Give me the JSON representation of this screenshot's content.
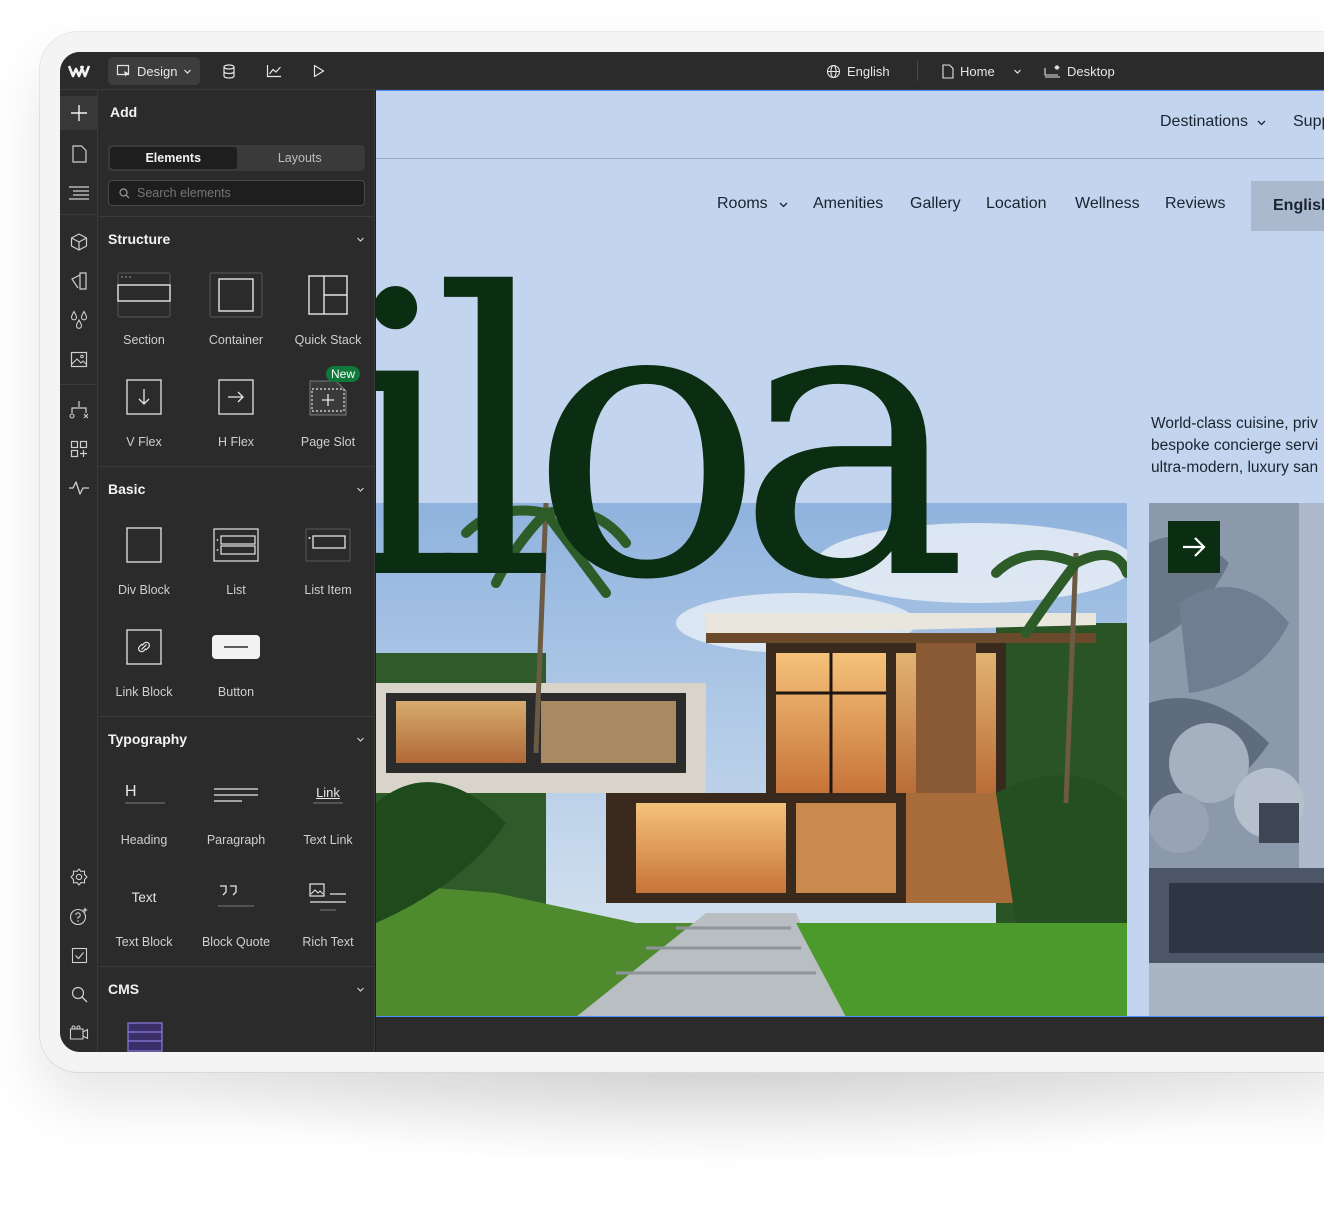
{
  "app": {
    "mode_label": "Design",
    "language": "English",
    "page": "Home",
    "breakpoint": "Desktop"
  },
  "panel": {
    "title": "Add",
    "tabs": [
      "Elements",
      "Layouts"
    ],
    "search_placeholder": "Search elements",
    "new_badge": "New",
    "sections": {
      "structure": {
        "title": "Structure",
        "items": [
          "Section",
          "Container",
          "Quick Stack",
          "V Flex",
          "H Flex",
          "Page Slot"
        ]
      },
      "basic": {
        "title": "Basic",
        "items": [
          "Div Block",
          "List",
          "List Item",
          "Link Block",
          "Button"
        ]
      },
      "typography": {
        "title": "Typography",
        "items": [
          "Heading",
          "Paragraph",
          "Text Link",
          "Text Block",
          "Block Quote",
          "Rich Text"
        ],
        "heading_glyph": "H",
        "link_glyph": "Link",
        "text_glyph": "Text"
      },
      "cms": {
        "title": "CMS"
      }
    }
  },
  "site": {
    "nav_top": {
      "destinations": "Destinations",
      "support": "Supp"
    },
    "nav_main": [
      "Rooms",
      "Amenities",
      "Gallery",
      "Location",
      "Wellness",
      "Reviews"
    ],
    "lang_button": "English",
    "hero_word": "iloa",
    "copy_lines": [
      "World-class cuisine, priv",
      "bespoke concierge servi",
      "ultra-modern, luxury san"
    ]
  },
  "colors": {
    "canvas_bg": "#c3d5ee",
    "brand_green": "#0b2e12",
    "ui_dark": "#2b2b2b",
    "accent_blue": "#4a8cff",
    "badge_green": "#0d7a3a"
  }
}
